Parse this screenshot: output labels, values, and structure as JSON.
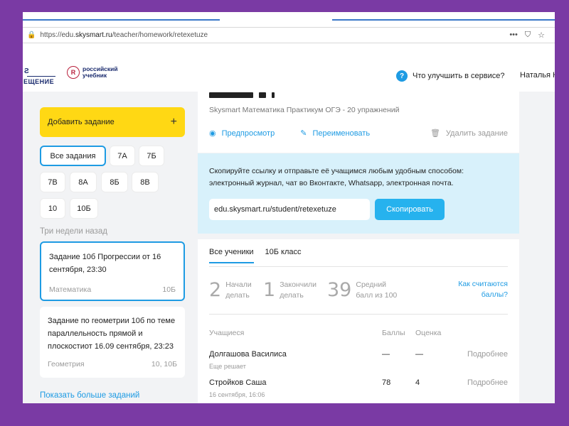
{
  "browser": {
    "url_prefix": "https://edu.",
    "url_host": "skysmart.ru",
    "url_path": "/teacher/homework/retexetuze"
  },
  "header": {
    "logo_prosveshchenie": "ЕЩЕНИЕ",
    "logo_uchebnik_line1": "российский",
    "logo_uchebnik_line2": "учебник",
    "help_text": "Что улучшить в сервисе?",
    "user_name": "Наталья Н"
  },
  "sidebar": {
    "add_task_label": "Добавить задание",
    "classes": [
      {
        "label": "Все задания",
        "active": true
      },
      {
        "label": "7А"
      },
      {
        "label": "7Б"
      },
      {
        "label": "7В"
      },
      {
        "label": "8А"
      },
      {
        "label": "8Б"
      },
      {
        "label": "8В"
      },
      {
        "label": "10"
      },
      {
        "label": "10Б"
      }
    ],
    "section_label": "Три недели назад",
    "tasks": [
      {
        "title": "Задание 10б Прогрессии от 16 сентября, 23:30",
        "subject": "Математика",
        "class": "10Б"
      },
      {
        "title": "Задание по геометрии 10б по теме параллельность прямой и плоскостиот 16.09 сентября, 23:23",
        "subject": "Геометрия",
        "class": "10, 10Б"
      }
    ],
    "more_link": "Показать больше заданий"
  },
  "main": {
    "subtitle": "Skysmart Математика Практикум ОГЭ - 20 упражнений",
    "actions": {
      "preview": "Предпросмотр",
      "rename": "Переименовать",
      "delete": "Удалить задание"
    },
    "share": {
      "text": "Скопируйте ссылку и отправьте её учащимся любым удобным способом: электронный журнал, чат во Вконтакте, Whatsapp, электронная почта.",
      "link": "edu.skysmart.ru/student/retexetuze",
      "copy_button": "Скопировать"
    },
    "stats": {
      "tabs": [
        {
          "label": "Все ученики",
          "active": true
        },
        {
          "label": "10Б класс"
        }
      ],
      "started_count": "2",
      "started_label_1": "Начали",
      "started_label_2": "делать",
      "finished_count": "1",
      "finished_label_1": "Закончили",
      "finished_label_2": "делать",
      "avg_score": "39",
      "avg_label_1": "Средний",
      "avg_label_2": "балл из 100",
      "how_link_1": "Как считаются",
      "how_link_2": "баллы?",
      "columns": {
        "student": "Учащиеся",
        "score": "Баллы",
        "grade": "Оценка"
      },
      "rows": [
        {
          "name": "Долгашова Василиса",
          "sub": "Еще решает",
          "score": "—",
          "grade": "—",
          "detail": "Подробнее"
        },
        {
          "name": "Стройков Саша",
          "sub": "16 сентября, 16:06",
          "score": "78",
          "grade": "4",
          "detail": "Подробнее"
        }
      ]
    }
  },
  "colors": {
    "accent": "#1e9be3",
    "yellow": "#ffd814",
    "share_bg": "#d8f1fb",
    "frame": "#7a3aa4"
  }
}
